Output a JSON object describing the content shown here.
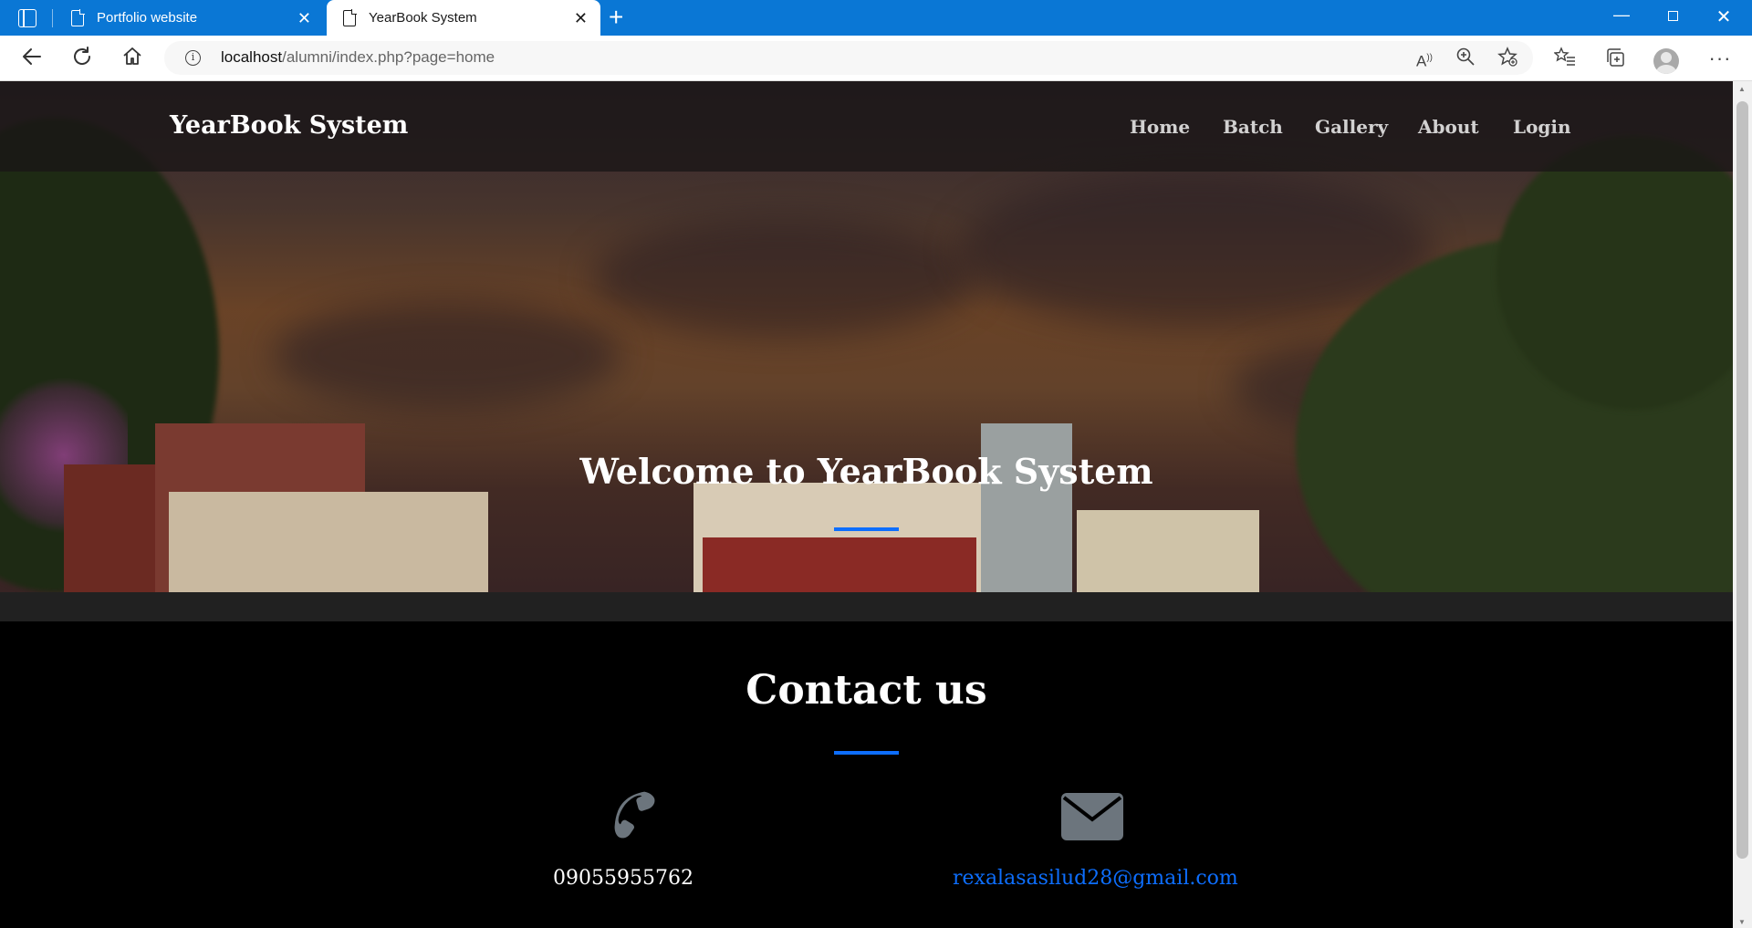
{
  "browser": {
    "tabs": [
      {
        "title": "Portfolio website",
        "active": false
      },
      {
        "title": "YearBook System",
        "active": true
      }
    ],
    "url": {
      "host": "localhost",
      "path": "/alumni/index.php?page=home"
    },
    "accent_color": "#0a77d5"
  },
  "site": {
    "brand": "YearBook System",
    "nav": [
      "Home",
      "Batch",
      "Gallery",
      "About",
      "Login"
    ],
    "hero_title": "Welcome to YearBook System",
    "accent_color": "#0d6efd"
  },
  "contact": {
    "title": "Contact us",
    "phone": "09055955762",
    "email": "rexalasasilud28@gmail.com",
    "icons": [
      "phone-icon",
      "envelope-icon"
    ]
  }
}
